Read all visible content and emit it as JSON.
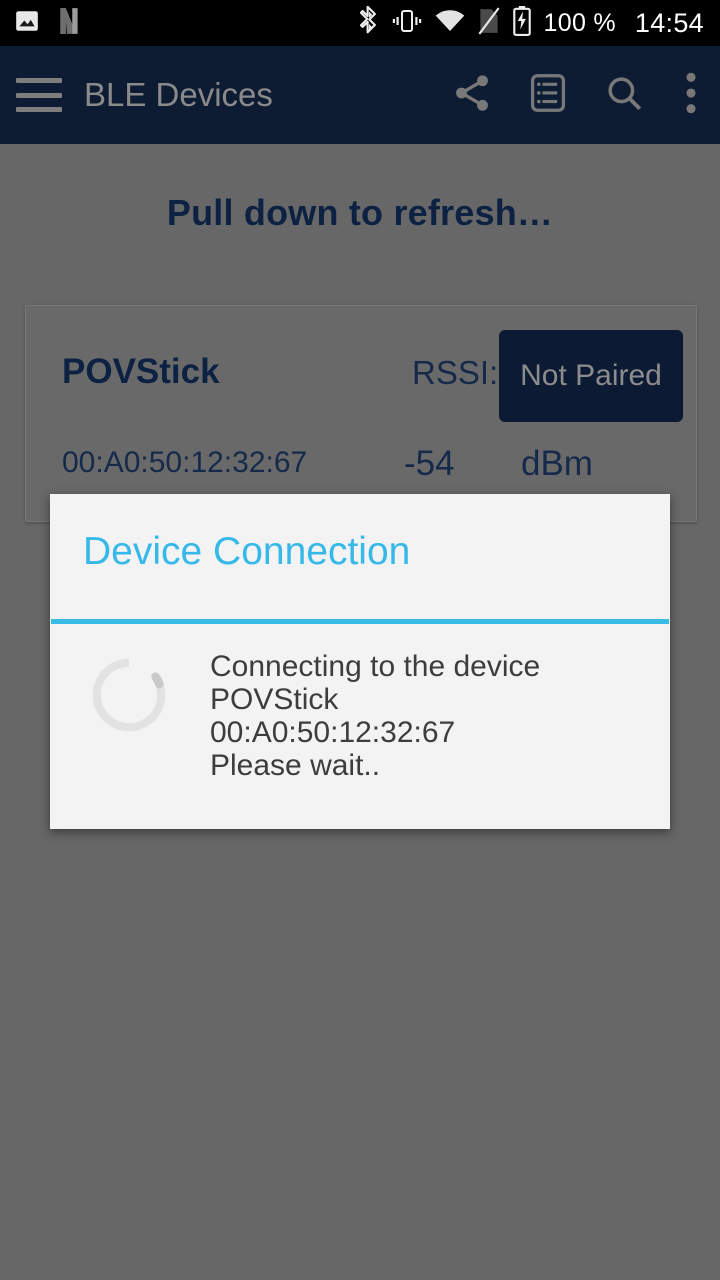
{
  "statusbar": {
    "icons_left": [
      "image-icon",
      "netflix-n-icon"
    ],
    "icons_right": [
      "bluetooth-icon",
      "vibrate-icon",
      "wifi-icon",
      "no-sim-icon",
      "battery-charging-icon"
    ],
    "battery_text": "100 %",
    "clock": "14:54"
  },
  "toolbar": {
    "menu_icon": "hamburger-menu-icon",
    "title": "BLE Devices",
    "actions": [
      {
        "name": "share-icon",
        "label": "Share"
      },
      {
        "name": "log-list-icon",
        "label": "Log"
      },
      {
        "name": "search-icon",
        "label": "Search"
      },
      {
        "name": "overflow-menu-icon",
        "label": "More options"
      }
    ]
  },
  "content": {
    "pull_to_refresh": "Pull down to refresh…"
  },
  "device_card": {
    "name": "POVStick",
    "mac_address": "00:A0:50:12:32:67",
    "rssi_label": "RSSI:",
    "rssi_value": "-54",
    "rssi_unit": "dBm",
    "pair_status": "Not Paired"
  },
  "dialog": {
    "title": "Device Connection",
    "spinner": "loading-spinner-icon",
    "message_lines": [
      "Connecting to the device",
      "POVStick",
      "00:A0:50:12:32:67",
      "Please wait.."
    ]
  },
  "colors": {
    "statusbar_bg": "#000000",
    "toolbar_bg": "#0d1b33",
    "toolbar_text": "#8a8a8a",
    "scrim_bg": "#676767",
    "card_bg": "#696969",
    "navy_text": "#152a4a",
    "badge_bg": "#0c1a33",
    "dialog_bg": "#f3f3f3",
    "accent_blue": "#37bae3",
    "dialog_text": "#3d3d3d"
  }
}
